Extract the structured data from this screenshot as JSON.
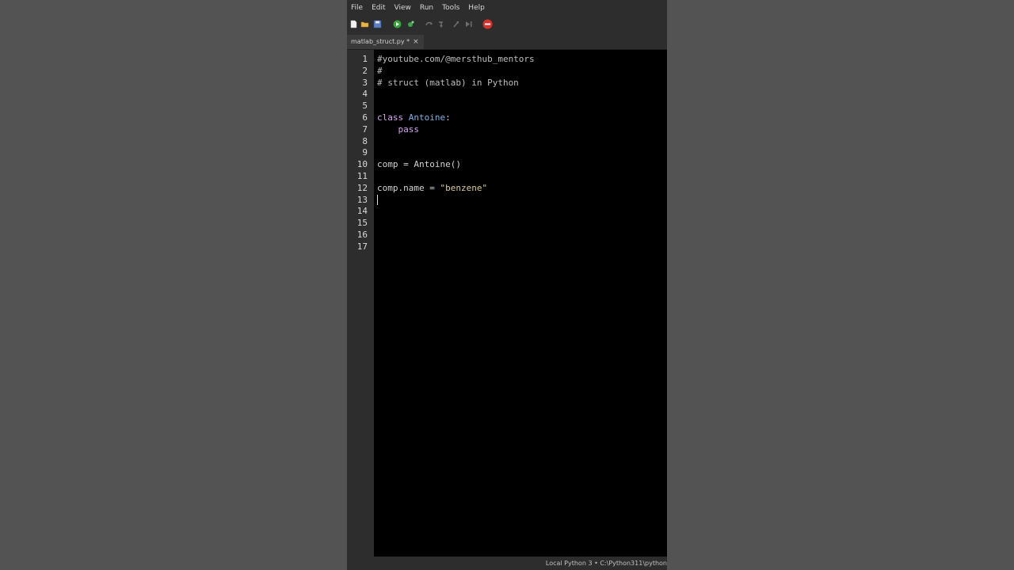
{
  "menu": [
    "File",
    "Edit",
    "View",
    "Run",
    "Tools",
    "Help"
  ],
  "tab": {
    "label": "matlab_struct.py *",
    "close": "×"
  },
  "line_numbers": [
    "1",
    "2",
    "3",
    "4",
    "5",
    "6",
    "7",
    "8",
    "9",
    "10",
    "11",
    "12",
    "13",
    "14",
    "15",
    "16",
    "17"
  ],
  "code": {
    "l1": "#youtube.com/@mersthub_mentors",
    "l2": "#",
    "l3": "# struct (matlab) in Python",
    "l6_kw": "class",
    "l6_name": "Antoine",
    "l6_colon": ":",
    "l7_indent": "    ",
    "l7_kw": "pass",
    "l10": "comp = Antoine()",
    "l12_pre": "comp.name = ",
    "l12_str": "\"benzene\""
  },
  "status": {
    "interpreter": "Local Python 3",
    "separator": "•",
    "path": "C:\\Python311\\python"
  },
  "colors": {
    "keyword": "#d6a6ef",
    "class_name": "#7fb0e6",
    "string": "#d8c89a",
    "editor_bg": "#000000"
  },
  "toolbar_icons": [
    "new-file-icon",
    "open-folder-icon",
    "save-icon",
    "run-icon",
    "debug-icon",
    "step-over-icon",
    "step-into-icon",
    "step-out-icon",
    "resume-icon",
    "stop-icon"
  ]
}
